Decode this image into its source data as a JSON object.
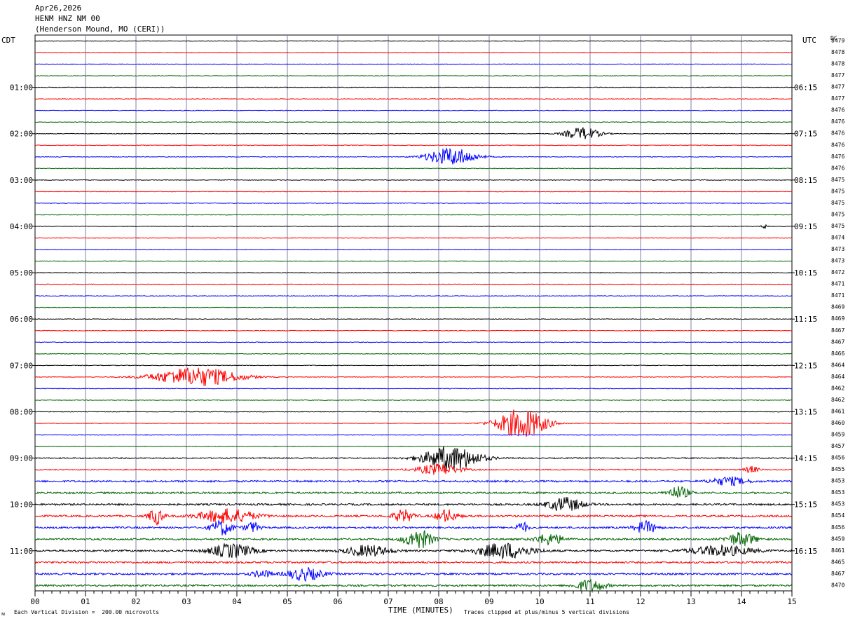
{
  "header": {
    "date": "Apr26,2026",
    "station": "HENM HNZ NM 00",
    "location": "(Henderson Mound, MO (CERI))"
  },
  "left_tz": "CDT",
  "right_tz": "UTC",
  "dc_label": "DC",
  "footer": {
    "scale": "Each Vertical Division =  200.00 microvolts",
    "xlabel": "TIME (MINUTES)",
    "clip": "Traces clipped at plus/minus 5 vertical divisions",
    "corner": "ᴍ"
  },
  "chart_data": {
    "type": "line",
    "xlabel": "TIME (MINUTES)",
    "x_ticks": [
      "00",
      "01",
      "02",
      "03",
      "04",
      "05",
      "06",
      "07",
      "08",
      "09",
      "10",
      "11",
      "12",
      "13",
      "14",
      "15"
    ],
    "xlim": [
      0,
      15
    ],
    "rows": 48,
    "colors": [
      "#000000",
      "#ff0000",
      "#0000ff",
      "#006400"
    ],
    "left_labels": [
      {
        "row": 4,
        "text": "01:00"
      },
      {
        "row": 8,
        "text": "02:00"
      },
      {
        "row": 12,
        "text": "03:00"
      },
      {
        "row": 16,
        "text": "04:00"
      },
      {
        "row": 20,
        "text": "05:00"
      },
      {
        "row": 24,
        "text": "06:00"
      },
      {
        "row": 28,
        "text": "07:00"
      },
      {
        "row": 32,
        "text": "08:00"
      },
      {
        "row": 36,
        "text": "09:00"
      },
      {
        "row": 40,
        "text": "10:00"
      },
      {
        "row": 44,
        "text": "11:00"
      }
    ],
    "right_labels": [
      {
        "row": 4,
        "text": "06:15"
      },
      {
        "row": 8,
        "text": "07:15"
      },
      {
        "row": 12,
        "text": "08:15"
      },
      {
        "row": 16,
        "text": "09:15"
      },
      {
        "row": 20,
        "text": "10:15"
      },
      {
        "row": 24,
        "text": "11:15"
      },
      {
        "row": 28,
        "text": "12:15"
      },
      {
        "row": 32,
        "text": "13:15"
      },
      {
        "row": 36,
        "text": "14:15"
      },
      {
        "row": 40,
        "text": "15:15"
      },
      {
        "row": 44,
        "text": "16:15"
      }
    ],
    "dc_values": [
      "8479",
      "8478",
      "8478",
      "8477",
      "8477",
      "8477",
      "8476",
      "8476",
      "8476",
      "8476",
      "8476",
      "8476",
      "8475",
      "8475",
      "8475",
      "8475",
      "8475",
      "8474",
      "8473",
      "8473",
      "8472",
      "8471",
      "8471",
      "8469",
      "8469",
      "8467",
      "8467",
      "8466",
      "8464",
      "8464",
      "8462",
      "8462",
      "8461",
      "8460",
      "8459",
      "8457",
      "8456",
      "8455",
      "8453",
      "8453",
      "8453",
      "8454",
      "8456",
      "8459",
      "8461",
      "8465",
      "8467",
      "8470"
    ],
    "events": [
      {
        "row": 8,
        "t": 10.85,
        "amp": 9,
        "w": 0.5
      },
      {
        "row": 10,
        "t": 8.25,
        "amp": 13,
        "w": 0.7
      },
      {
        "row": 16,
        "t": 14.45,
        "amp": 3,
        "w": 0.08
      },
      {
        "row": 29,
        "t": 3.2,
        "amp": 14,
        "w": 1.2
      },
      {
        "row": 33,
        "t": 9.65,
        "amp": 22,
        "w": 0.7
      },
      {
        "row": 36,
        "t": 8.25,
        "amp": 18,
        "w": 0.8
      },
      {
        "row": 37,
        "t": 8.0,
        "amp": 8,
        "w": 0.6
      },
      {
        "row": 37,
        "t": 14.2,
        "amp": 5,
        "w": 0.2
      },
      {
        "row": 38,
        "t": 13.75,
        "amp": 6,
        "w": 0.5
      },
      {
        "row": 39,
        "t": 12.75,
        "amp": 9,
        "w": 0.3
      },
      {
        "row": 40,
        "t": 10.5,
        "amp": 10,
        "w": 0.5
      },
      {
        "row": 41,
        "t": 2.4,
        "amp": 12,
        "w": 0.2
      },
      {
        "row": 41,
        "t": 3.8,
        "amp": 10,
        "w": 0.8
      },
      {
        "row": 41,
        "t": 7.3,
        "amp": 9,
        "w": 0.3
      },
      {
        "row": 41,
        "t": 8.15,
        "amp": 9,
        "w": 0.3
      },
      {
        "row": 42,
        "t": 3.7,
        "amp": 11,
        "w": 0.3
      },
      {
        "row": 42,
        "t": 4.3,
        "amp": 8,
        "w": 0.2
      },
      {
        "row": 42,
        "t": 9.65,
        "amp": 9,
        "w": 0.15
      },
      {
        "row": 42,
        "t": 12.1,
        "amp": 9,
        "w": 0.3
      },
      {
        "row": 43,
        "t": 7.6,
        "amp": 14,
        "w": 0.4
      },
      {
        "row": 43,
        "t": 10.2,
        "amp": 8,
        "w": 0.4
      },
      {
        "row": 43,
        "t": 14.0,
        "amp": 10,
        "w": 0.4
      },
      {
        "row": 44,
        "t": 3.9,
        "amp": 10,
        "w": 0.6
      },
      {
        "row": 44,
        "t": 6.6,
        "amp": 8,
        "w": 0.6
      },
      {
        "row": 44,
        "t": 9.3,
        "amp": 11,
        "w": 0.8
      },
      {
        "row": 44,
        "t": 13.6,
        "amp": 7,
        "w": 0.9
      },
      {
        "row": 46,
        "t": 5.35,
        "amp": 9,
        "w": 0.5
      },
      {
        "row": 46,
        "t": 4.5,
        "amp": 5,
        "w": 0.3
      },
      {
        "row": 47,
        "t": 11.0,
        "amp": 9,
        "w": 0.4
      }
    ]
  }
}
